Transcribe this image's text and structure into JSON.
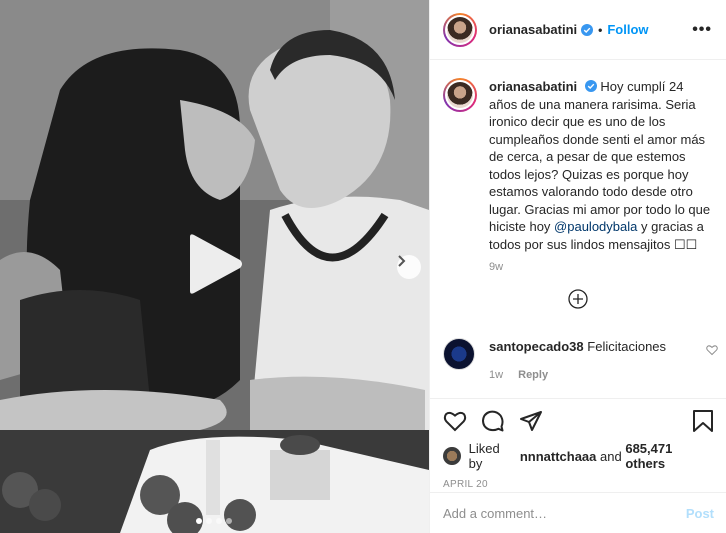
{
  "post": {
    "media_label": "video post",
    "carousel": {
      "count": 4,
      "active": 0
    }
  },
  "header": {
    "username": "orianasabatini",
    "separator": "•",
    "follow_label": "Follow",
    "more_label": "•••"
  },
  "caption": {
    "username": "orianasabatini",
    "text_before": "Hoy cumplí 24 años de una manera rarisima. Seria ironico decir que es uno de los cumpleaños donde senti el amor más de cerca, a pesar de que estemos todos lejos? Quizas es porque hoy estamos valorando todo desde otro lugar. Gracias mi amor por todo lo que hiciste hoy ",
    "mention": "@paulodybala",
    "text_after": " y gracias a todos por sus lindos mensajitos ☐☐",
    "time": "9w"
  },
  "comments": [
    {
      "username": "santopecado38",
      "text": "Felicitaciones",
      "time": "1w",
      "reply_label": "Reply"
    }
  ],
  "likes": {
    "prefix": "Liked by",
    "user": "nnnattchaaa",
    "middle": "and",
    "others": "685,471 others"
  },
  "date": "APRIL 20",
  "add_comment": {
    "placeholder": "Add a comment…",
    "post_label": "Post"
  },
  "colors": {
    "accent": "#0095f6",
    "mention": "#00376b",
    "muted": "#8e8e8e",
    "post_disabled": "#b2dffc"
  },
  "icons": [
    "play-icon",
    "chevron-right-icon",
    "verified-icon",
    "more-icon",
    "plus-circle-icon",
    "heart-icon",
    "comment-icon",
    "share-icon",
    "bookmark-icon"
  ]
}
